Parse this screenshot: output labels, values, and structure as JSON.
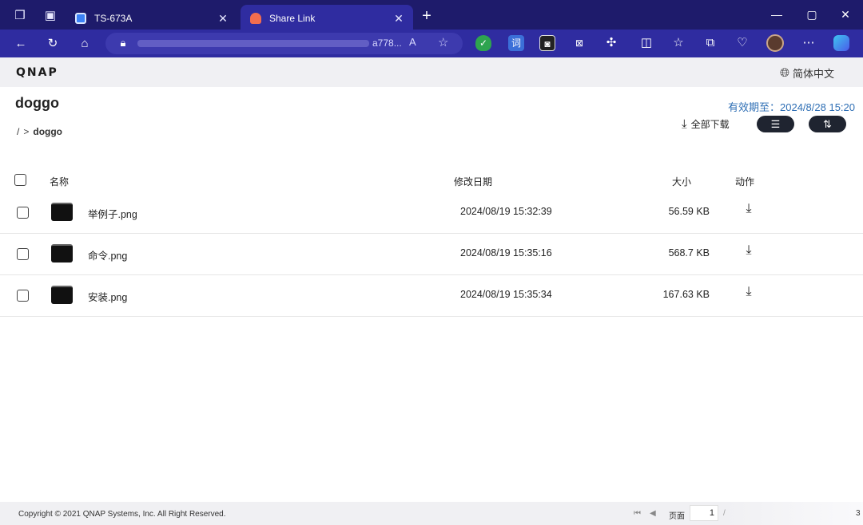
{
  "browser": {
    "tabs": [
      {
        "label": "TS-673A",
        "icon": "qnap-favicon"
      },
      {
        "label": "Share Link",
        "icon": "share-link-favicon"
      }
    ],
    "url_visible_fragment": "a778...",
    "window_controls": [
      "minimize",
      "maximize",
      "close"
    ]
  },
  "header": {
    "logo": "QNAP",
    "language": "简体中文"
  },
  "folder": {
    "title": "doggo",
    "breadcrumb_root": "/",
    "breadcrumb_sep": ">",
    "breadcrumb_current": "doggo",
    "expire": "有效期至：2024/8/28 15:20",
    "download_all": "全部下载"
  },
  "table": {
    "headers": {
      "name": "名称",
      "modified": "修改日期",
      "size": "大小",
      "action": "动作"
    },
    "rows": [
      {
        "name": "举例子.png",
        "modified": "2024/08/19 15:32:39",
        "size": "56.59 KB"
      },
      {
        "name": "命令.png",
        "modified": "2024/08/19 15:35:16",
        "size": "568.7 KB"
      },
      {
        "name": "安装.png",
        "modified": "2024/08/19 15:35:34",
        "size": "167.63 KB"
      }
    ]
  },
  "footer": {
    "copyright": "Copyright © 2021 QNAP Systems, Inc. All Right Reserved.",
    "page_label": "页面",
    "page_value": "1",
    "page_sep": "/",
    "page_total": "3"
  }
}
